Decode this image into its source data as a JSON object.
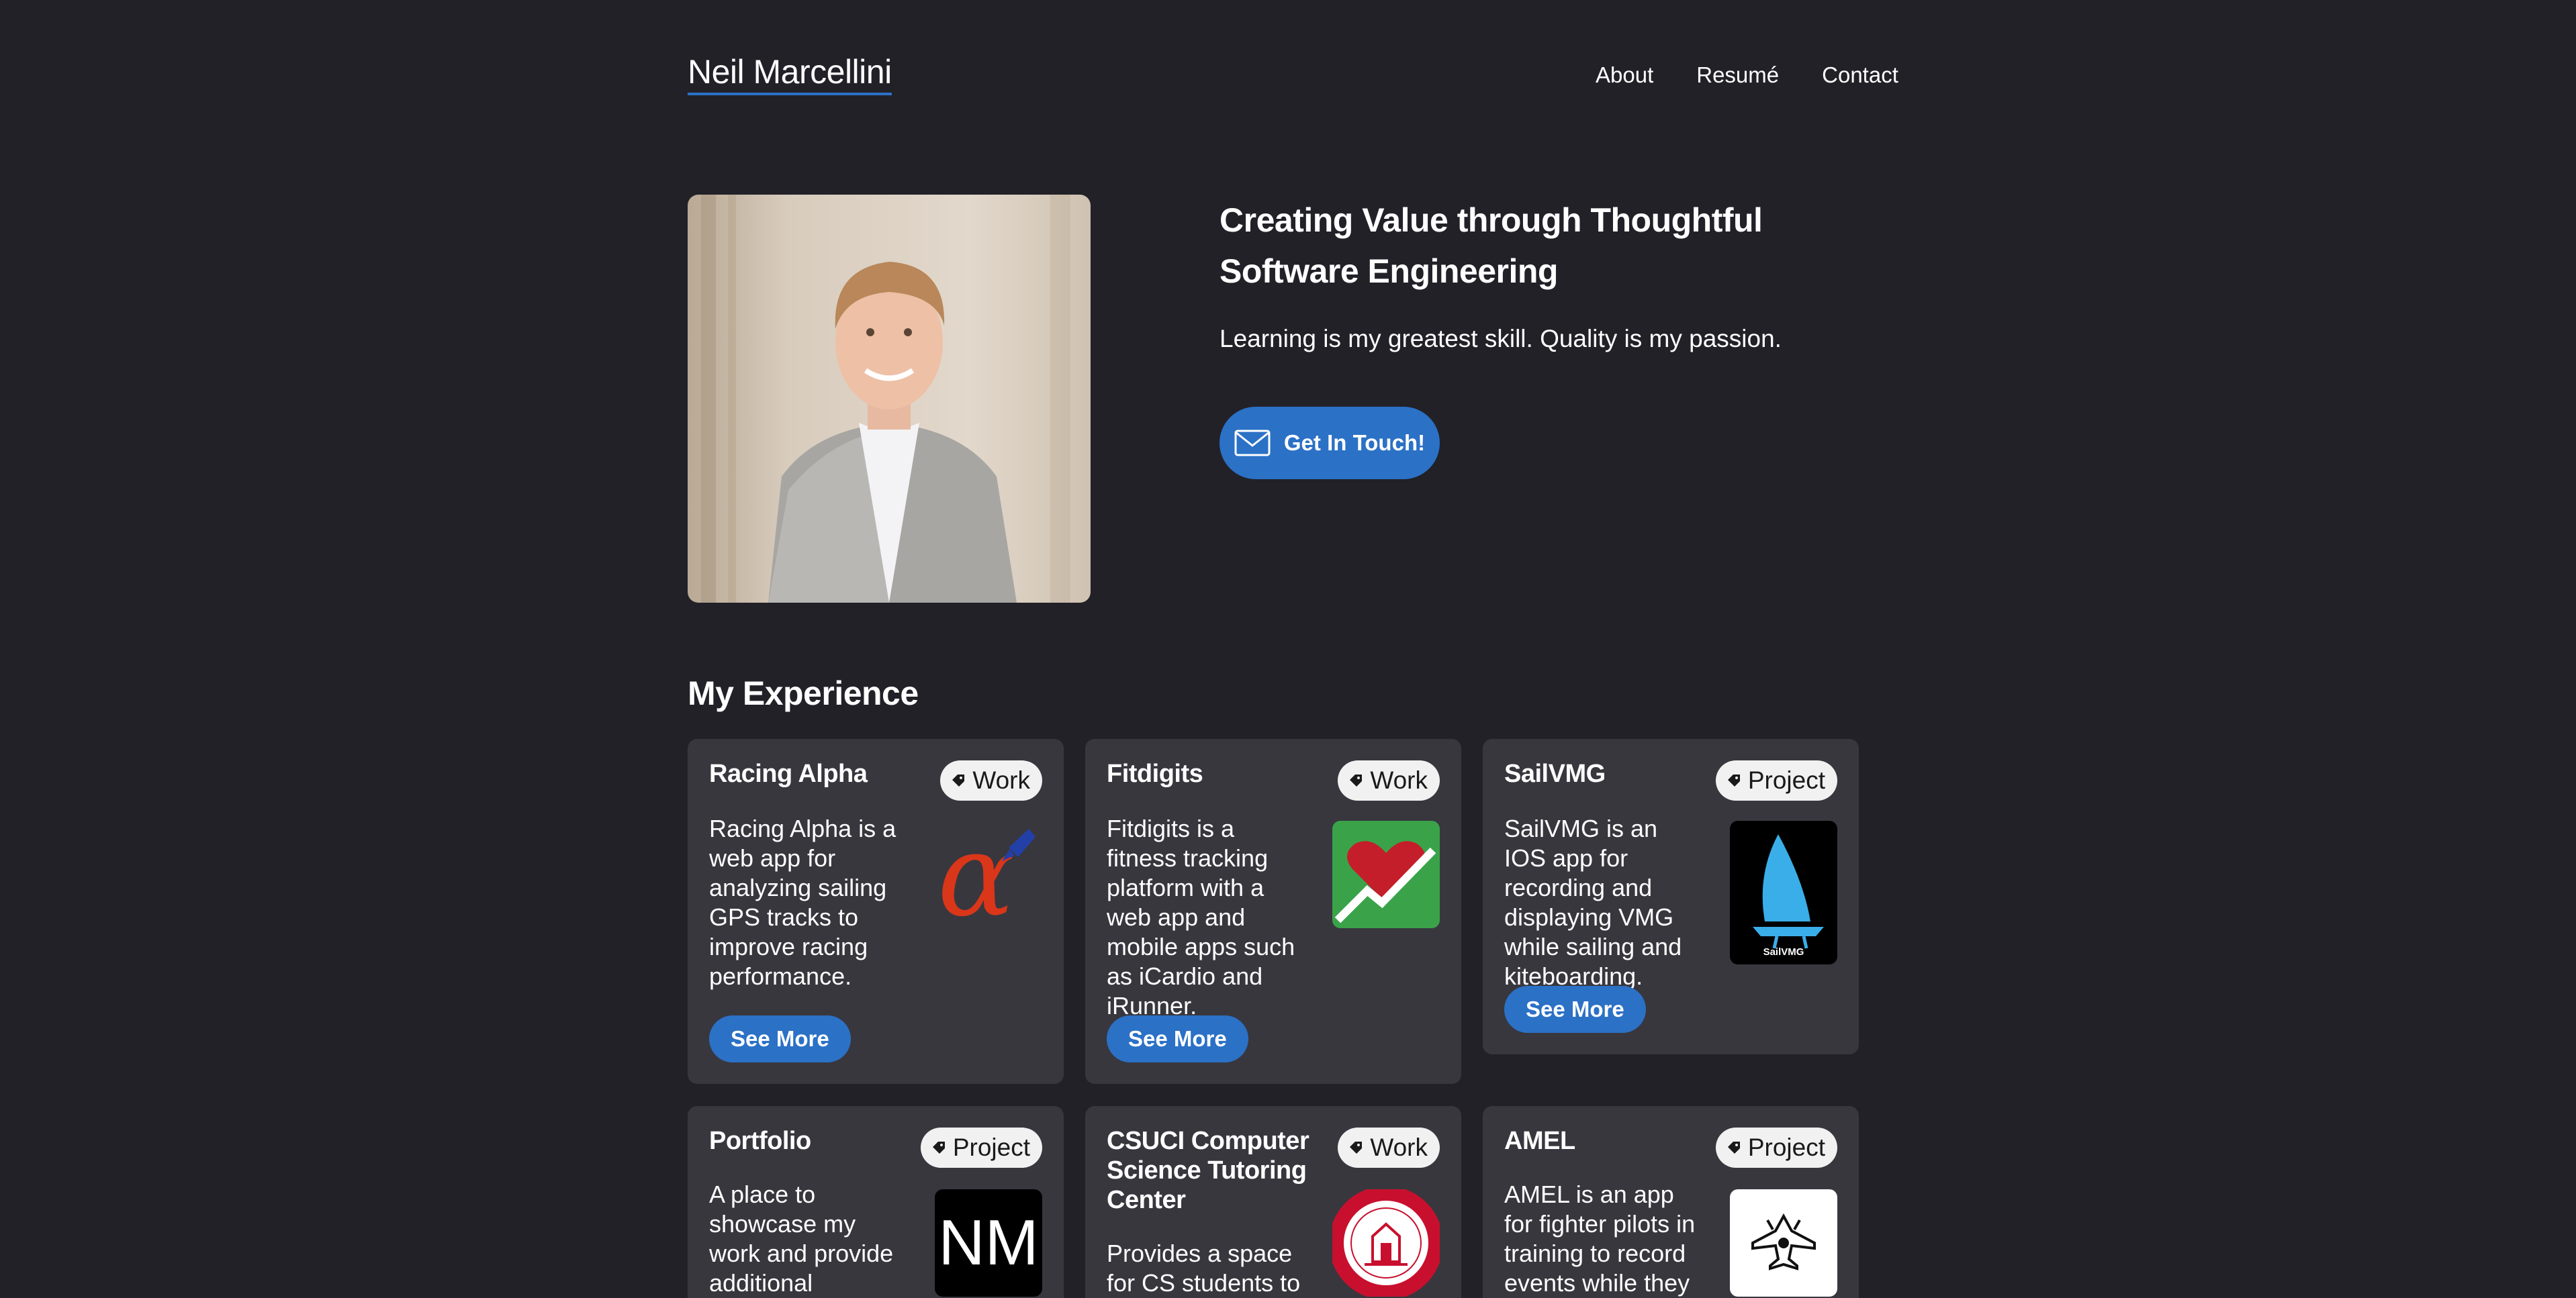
{
  "header": {
    "brand": "Neil Marcellini",
    "nav": [
      "About",
      "Resumé",
      "Contact"
    ]
  },
  "hero": {
    "title": "Creating Value through Thoughtful Software Engineering",
    "tagline": "Learning is my greatest skill. Quality is my passion.",
    "cta_label": "Get In Touch!",
    "cta_icon": "mail-icon"
  },
  "experience": {
    "heading": "My Experience",
    "cards": [
      {
        "title": "Racing Alpha",
        "tag": "Work",
        "description": "Racing Alpha is a web app for analyzing sailing GPS tracks to improve racing performance.",
        "button": "See More",
        "logo": "racing-alpha-logo"
      },
      {
        "title": "Fitdigits",
        "tag": "Work",
        "description": "Fitdigits is a fitness tracking platform with a web app and mobile apps such as iCardio and iRunner.",
        "button": "See More",
        "logo": "fitdigits-logo"
      },
      {
        "title": "SailVMG",
        "tag": "Project",
        "description": "SailVMG is an IOS app for recording and displaying VMG while sailing and kiteboarding.",
        "button": "See More",
        "logo": "sailvmg-logo",
        "logo_caption": "SailVMG"
      },
      {
        "title": "Portfolio",
        "tag": "Project",
        "description": "A place to showcase my work and provide additional",
        "logo": "portfolio-logo",
        "logo_text": "NM"
      },
      {
        "title": "CSUCI Computer Science Tutoring Center",
        "tag": "Work",
        "description": "Provides a space for CS students to",
        "logo": "csuci-seal-logo"
      },
      {
        "title": "AMEL",
        "tag": "Project",
        "description": "AMEL is an app for fighter pilots in training to record events while they",
        "logo": "amel-logo"
      }
    ]
  },
  "colors": {
    "background": "#222128",
    "card": "#38373e",
    "accent": "#2b71c6",
    "tag_bg": "#f1f1f1"
  }
}
